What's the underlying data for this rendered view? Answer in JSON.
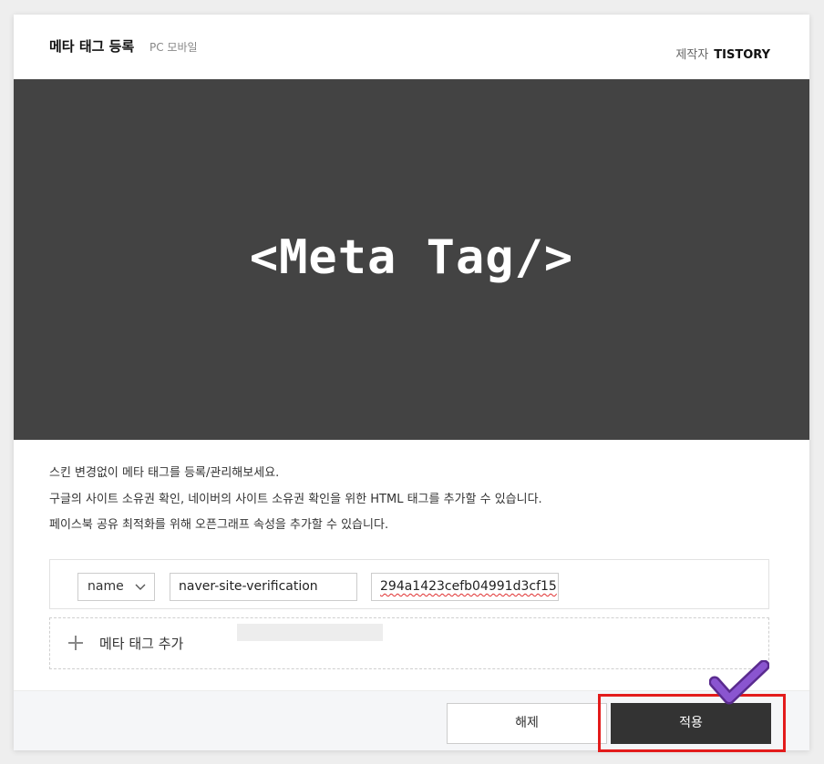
{
  "header": {
    "title": "메타 태그 등록",
    "subtitle": "PC 모바일",
    "author_label": "제작자",
    "author_name": "TISTORY"
  },
  "preview": {
    "text": "<Meta Tag/>"
  },
  "description": {
    "lines": [
      "스킨 변경없이 메타 태그를 등록/관리해보세요.",
      "구글의 사이트 소유권 확인, 네이버의 사이트 소유권 확인을 위한 HTML 태그를 추가할 수 있습니다.",
      "페이스북 공유 최적화를 위해 오픈그래프 속성을 추가할 수 있습니다."
    ]
  },
  "meta_row": {
    "type_select": "name",
    "name_value": "naver-site-verification",
    "content_value": "294a1423cefb04991d3cf15"
  },
  "add_row": {
    "label": "메타 태그 추가"
  },
  "footer": {
    "cancel_label": "해제",
    "apply_label": "적용"
  },
  "colors": {
    "preview_bg": "#434343",
    "apply_bg": "#333333",
    "highlight": "#e31b1b",
    "check": "#7b3fbf"
  },
  "icons": [
    "chevron-down-icon",
    "plus-icon",
    "checkmark-icon"
  ]
}
